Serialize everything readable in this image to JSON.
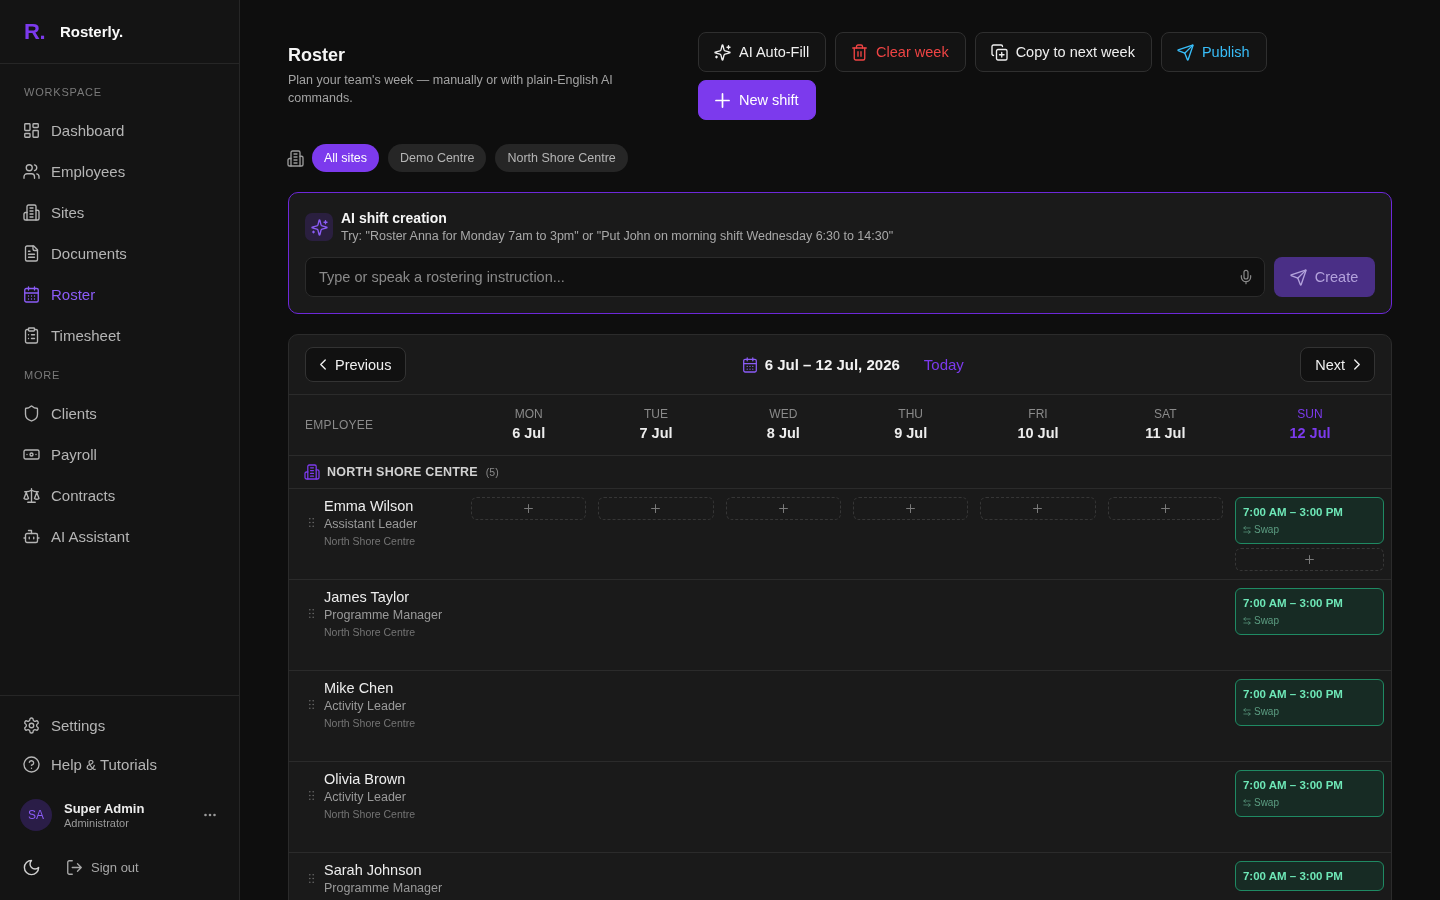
{
  "sidebar": {
    "brand": {
      "mark": "R.",
      "name": "Rosterly."
    },
    "sections": [
      {
        "label": "WORKSPACE",
        "items": [
          {
            "label": "Dashboard",
            "selected": false
          },
          {
            "label": "Employees",
            "selected": false
          },
          {
            "label": "Sites",
            "selected": false
          },
          {
            "label": "Documents",
            "selected": false
          },
          {
            "label": "Roster",
            "selected": true
          },
          {
            "label": "Timesheet",
            "selected": false
          }
        ]
      },
      {
        "label": "MORE",
        "items": [
          {
            "label": "Clients",
            "selected": false
          },
          {
            "label": "Payroll",
            "selected": false
          },
          {
            "label": "Contracts",
            "selected": false
          },
          {
            "label": "AI Assistant",
            "selected": false
          }
        ]
      }
    ],
    "footer_items": [
      {
        "label": "Settings",
        "selected": false
      },
      {
        "label": "Help & Tutorials",
        "selected": false
      }
    ],
    "user": {
      "initials": "SA",
      "name": "Super Admin",
      "role": "Administrator"
    },
    "sign_out": "Sign out"
  },
  "page_header": {
    "title": "Roster",
    "subtitle": "Plan your team's week — manually or with plain-English AI commands.",
    "actions": [
      {
        "label": "AI Auto-Fill",
        "kind": "default"
      },
      {
        "label": "Clear week",
        "kind": "danger"
      },
      {
        "label": "Copy to next week",
        "kind": "default"
      },
      {
        "label": "Publish",
        "kind": "info"
      },
      {
        "label": "New shift",
        "kind": "primary"
      }
    ]
  },
  "site_filter": [
    {
      "label": "All sites",
      "selected": true
    },
    {
      "label": "Demo Centre",
      "selected": false
    },
    {
      "label": "North Shore Centre",
      "selected": false
    }
  ],
  "ai_panel": {
    "title": "AI shift creation",
    "hint": "Try: \"Roster Anna for Monday 7am to 3pm\" or \"Put John on morning shift Wednesday 6:30 to 14:30\"",
    "input": {
      "placeholder": "Type or speak a rostering instruction..."
    },
    "submit": {
      "label": "Create",
      "disabled": true
    }
  },
  "roster": {
    "nav": {
      "previous": "Previous",
      "range": "6 Jul – 12 Jul, 2026",
      "today": "Today",
      "next": "Next"
    },
    "employee_column": "EMPLOYEE",
    "days": [
      {
        "weekday": "MON",
        "date": "6 Jul",
        "today": false
      },
      {
        "weekday": "TUE",
        "date": "7 Jul",
        "today": false
      },
      {
        "weekday": "WED",
        "date": "8 Jul",
        "today": false
      },
      {
        "weekday": "THU",
        "date": "9 Jul",
        "today": false
      },
      {
        "weekday": "FRI",
        "date": "10 Jul",
        "today": false
      },
      {
        "weekday": "SAT",
        "date": "11 Jul",
        "today": false
      },
      {
        "weekday": "SUN",
        "date": "12 Jul",
        "today": true
      }
    ],
    "groups": [
      {
        "name": "NORTH SHORE CENTRE",
        "count": "(5)",
        "employees": [
          {
            "name": "Emma Wilson",
            "role": "Assistant Leader",
            "site": "North Shore Centre",
            "cells": [
              {
                "kind": "add"
              },
              {
                "kind": "add"
              },
              {
                "kind": "add"
              },
              {
                "kind": "add"
              },
              {
                "kind": "add"
              },
              {
                "kind": "add"
              },
              {
                "kind": "shift",
                "time": "7:00 AM – 3:00 PM",
                "swap": "Swap",
                "add_below": true
              }
            ]
          },
          {
            "name": "James Taylor",
            "role": "Programme Manager",
            "site": "North Shore Centre",
            "cells": [
              {
                "kind": "empty"
              },
              {
                "kind": "empty"
              },
              {
                "kind": "empty"
              },
              {
                "kind": "empty"
              },
              {
                "kind": "empty"
              },
              {
                "kind": "empty"
              },
              {
                "kind": "shift",
                "time": "7:00 AM – 3:00 PM",
                "swap": "Swap",
                "add_below": false
              }
            ]
          },
          {
            "name": "Mike Chen",
            "role": "Activity Leader",
            "site": "North Shore Centre",
            "cells": [
              {
                "kind": "empty"
              },
              {
                "kind": "empty"
              },
              {
                "kind": "empty"
              },
              {
                "kind": "empty"
              },
              {
                "kind": "empty"
              },
              {
                "kind": "empty"
              },
              {
                "kind": "shift",
                "time": "7:00 AM – 3:00 PM",
                "swap": "Swap",
                "add_below": false
              }
            ]
          },
          {
            "name": "Olivia Brown",
            "role": "Activity Leader",
            "site": "North Shore Centre",
            "cells": [
              {
                "kind": "empty"
              },
              {
                "kind": "empty"
              },
              {
                "kind": "empty"
              },
              {
                "kind": "empty"
              },
              {
                "kind": "empty"
              },
              {
                "kind": "empty"
              },
              {
                "kind": "shift",
                "time": "7:00 AM – 3:00 PM",
                "swap": "Swap",
                "add_below": false
              }
            ]
          },
          {
            "name": "Sarah Johnson",
            "role": "Programme Manager",
            "cells": [
              {
                "kind": "empty"
              },
              {
                "kind": "empty"
              },
              {
                "kind": "empty"
              },
              {
                "kind": "empty"
              },
              {
                "kind": "empty"
              },
              {
                "kind": "empty"
              },
              {
                "kind": "shift",
                "time": "7:00 AM – 3:00 PM",
                "add_below": false
              }
            ]
          }
        ]
      }
    ]
  }
}
